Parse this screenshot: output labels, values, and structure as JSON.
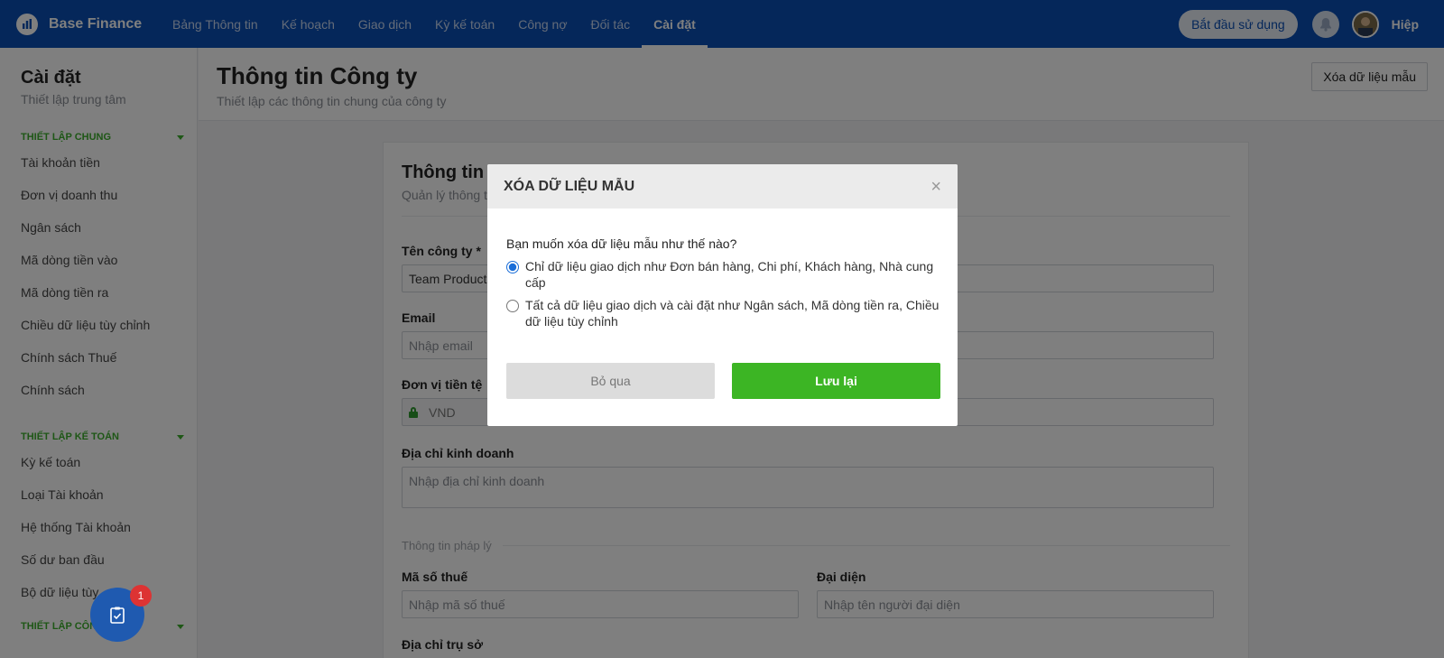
{
  "app": {
    "brand": "Base Finance",
    "nav": [
      "Bảng Thông tin",
      "Kế hoạch",
      "Giao dịch",
      "Kỳ kế toán",
      "Công nợ",
      "Đối tác",
      "Cài đặt"
    ],
    "active_nav": "Cài đặt",
    "start_button": "Bắt đầu sử dụng",
    "user_name": "Hiệp"
  },
  "sidebar": {
    "title": "Cài đặt",
    "subtitle": "Thiết lập trung tâm",
    "groups": [
      {
        "label": "THIẾT LẬP CHUNG",
        "items": [
          "Tài khoản tiền",
          "Đơn vị doanh thu",
          "Ngân sách",
          "Mã dòng tiền vào",
          "Mã dòng tiền ra",
          "Chiều dữ liệu tùy chỉnh",
          "Chính sách Thuế",
          "Chính sách"
        ]
      },
      {
        "label": "THIẾT LẬP KẾ TOÁN",
        "items": [
          "Kỳ kế toán",
          "Loại Tài khoản",
          "Hệ thống Tài khoản",
          "Số dư ban đầu",
          "Bộ dữ liệu tùy"
        ]
      },
      {
        "label": "THIẾT LẬP CÔNG TY",
        "items": []
      }
    ]
  },
  "page": {
    "title": "Thông tin Công ty",
    "subtitle": "Thiết lập các thông tin chung của công ty",
    "clear_button": "Xóa dữ liệu mẫu"
  },
  "card": {
    "title": "Thông tin C",
    "subtitle": "Quản lý thông t",
    "fields": {
      "company_name_label": "Tên công ty *",
      "company_name_value": "Team Product",
      "email_label": "Email",
      "email_placeholder": "Nhập email",
      "currency_label": "Đơn vị tiền tệ",
      "currency_value": "VND",
      "address_label": "Địa chỉ kinh doanh",
      "address_placeholder": "Nhập địa chỉ kinh doanh",
      "legal_section": "Thông tin pháp lý",
      "tax_label": "Mã số thuế",
      "tax_placeholder": "Nhập mã số thuế",
      "rep_label": "Đại diện",
      "rep_placeholder": "Nhập tên người đại diện",
      "hq_label": "Địa chỉ trụ sở"
    }
  },
  "modal": {
    "title": "XÓA DỮ LIỆU MẪU",
    "question": "Bạn muốn xóa dữ liệu mẫu như thế nào?",
    "options": [
      {
        "label": "Chỉ dữ liệu giao dịch như Đơn bán hàng, Chi phí, Khách hàng, Nhà cung cấp",
        "selected": true
      },
      {
        "label": "Tất cả dữ liệu giao dịch và cài đặt như Ngân sách, Mã dòng tiền ra, Chiều dữ liệu tùy chỉnh",
        "selected": false
      }
    ],
    "skip_button": "Bỏ qua",
    "save_button": "Lưu lại"
  },
  "fab": {
    "badge_count": "1"
  },
  "colors": {
    "primary": "#0a4fb5",
    "accent_green": "#3cb524",
    "group_label": "#3cae2c"
  }
}
